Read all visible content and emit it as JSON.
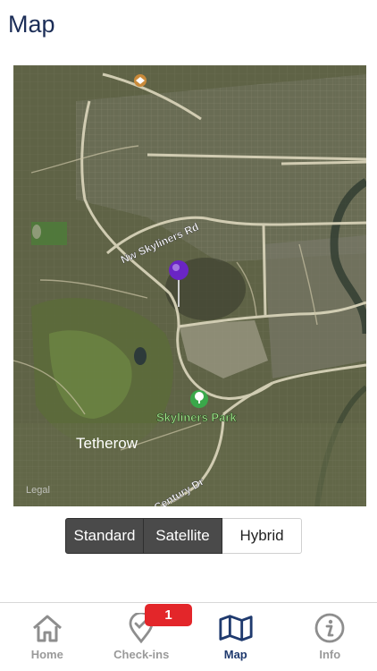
{
  "page": {
    "title": "Map"
  },
  "map": {
    "road_labels": [
      "Nw Skyliners Rd",
      "Century Dr"
    ],
    "place_labels": [
      "Skyliners Park",
      "Tetherow"
    ],
    "legal_label": "Legal",
    "pin_color": "#7b2fd6"
  },
  "map_type": {
    "options": [
      "Standard",
      "Satellite",
      "Hybrid"
    ],
    "selected": "Hybrid"
  },
  "tabbar": {
    "tabs": [
      {
        "label": "Home",
        "icon": "home-icon"
      },
      {
        "label": "Check-ins",
        "icon": "check-in-pin-icon"
      },
      {
        "label": "Map",
        "icon": "map-icon"
      },
      {
        "label": "Info",
        "icon": "info-icon"
      }
    ],
    "active": "Map",
    "checkins_badge": "1"
  },
  "colors": {
    "title": "#1b2d57",
    "active_tab": "#1f3a6e",
    "inactive_tab": "#9a9a9a",
    "badge": "#e3262a",
    "segment_dark": "#4a4a4a"
  }
}
